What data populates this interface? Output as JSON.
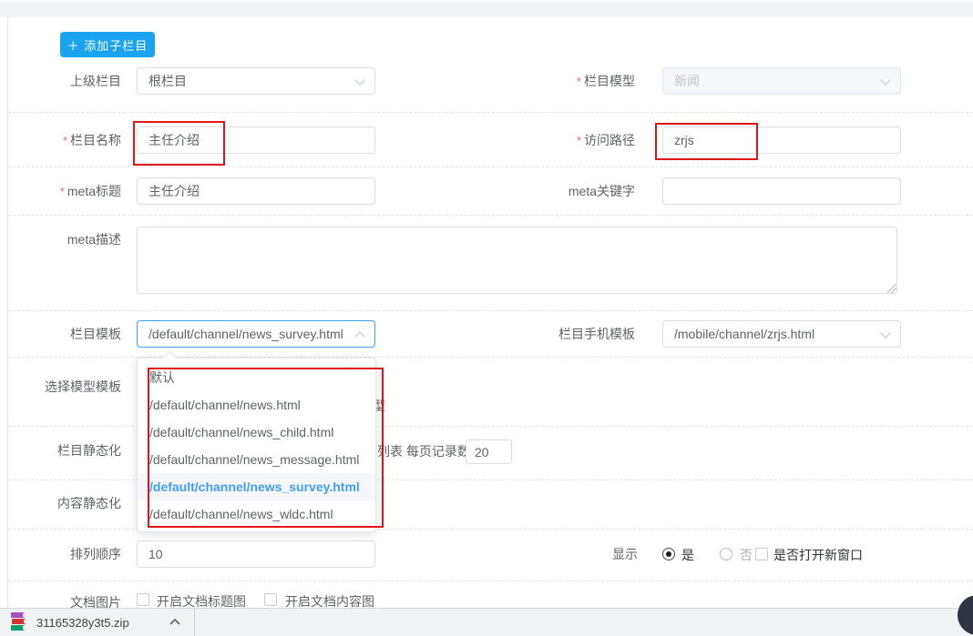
{
  "header": {
    "add_child_button": "＋ 添加子栏目"
  },
  "form": {
    "parent_channel": {
      "label": "上级栏目",
      "value": "根栏目"
    },
    "channel_model": {
      "label": "栏目模型",
      "required": "*",
      "value": "新闻",
      "disabled": true
    },
    "channel_name": {
      "label": "栏目名称",
      "required": "*",
      "value": "主任介绍"
    },
    "access_path": {
      "label": "访问路径",
      "required": "*",
      "value": "zrjs"
    },
    "meta_title": {
      "label": "meta标题",
      "required": "*",
      "value": "主任介绍"
    },
    "meta_keywords": {
      "label": "meta关键字",
      "value": "",
      "placeholder": ""
    },
    "meta_description": {
      "label": "meta描述",
      "value": ""
    },
    "channel_template": {
      "label": "栏目模板",
      "value": "/default/channel/news_survey.html",
      "open": true
    },
    "mobile_template": {
      "label": "栏目手机模板",
      "value": "/mobile/channel/zrjs.html"
    },
    "model_template": {
      "label": "选择模型模板",
      "obscured_fragment": "型"
    },
    "channel_static": {
      "label": "栏目静态化",
      "visible_text": "列表 每页记录数",
      "page_size": "20"
    },
    "content_static": {
      "label": "内容静态化"
    },
    "sort_order": {
      "label": "排列顺序",
      "value": "10"
    },
    "display": {
      "label": "显示",
      "option_yes": "是",
      "option_no": "否",
      "selected": "是",
      "open_new_window_label": "是否打开新窗口",
      "open_new_window_checked": false
    },
    "doc_image": {
      "label": "文档图片",
      "title_image_label": "开启文档标题图",
      "content_image_label": "开启文档内容图",
      "title_image_checked": false,
      "content_image_checked": false
    }
  },
  "template_dropdown": {
    "options": [
      "默认",
      "/default/channel/news.html",
      "/default/channel/news_child.html",
      "/default/channel/news_message.html",
      "/default/channel/news_survey.html",
      "/default/channel/news_wldc.html"
    ],
    "selected": "/default/channel/news_survey.html"
  },
  "download_bar": {
    "filename": "31165328y3t5.zip"
  },
  "icons": {
    "chevron_down": "chevron-down-icon",
    "chevron_up": "chevron-up-icon",
    "winrar": "winrar-archive-icon",
    "caret_up": "caret-up-icon"
  },
  "colors": {
    "primary_button": "#1aa4f0",
    "accent": "#409eff",
    "annotation_red": "#e01515",
    "disabled_bg": "#f5f7fa",
    "selected_option_bg": "#f5f7fa",
    "download_bar_bg": "#f1f2f3",
    "fab_circle": "#2e3440"
  }
}
